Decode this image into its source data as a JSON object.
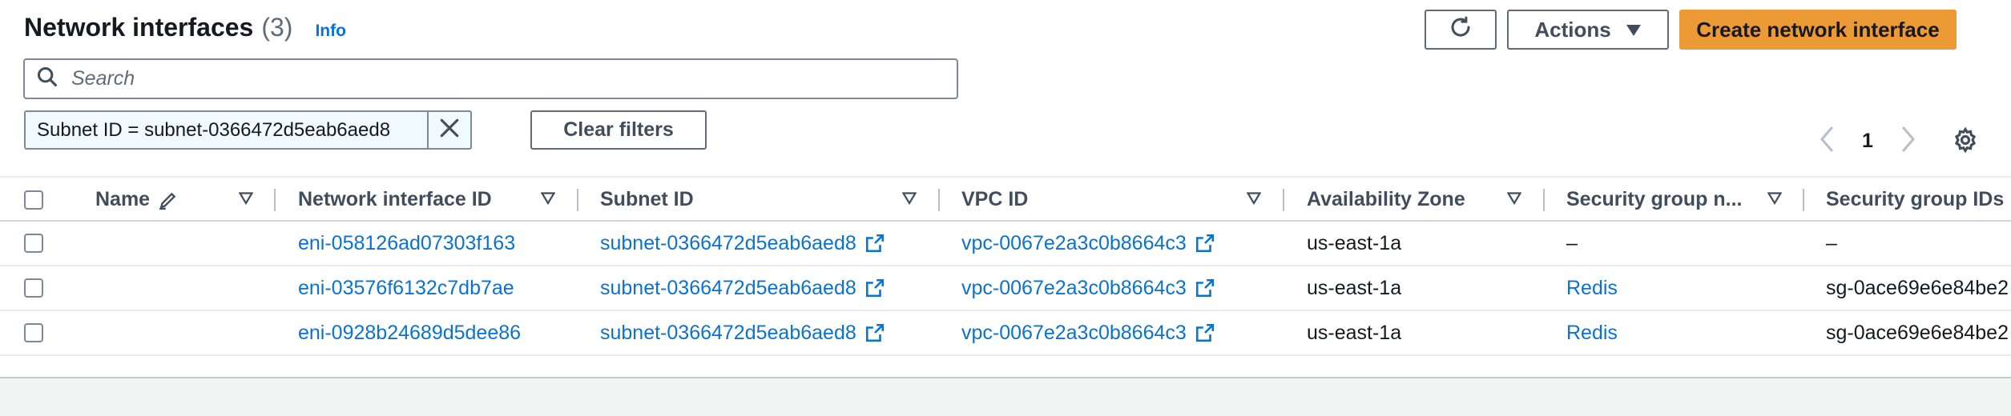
{
  "header": {
    "title": "Network interfaces",
    "count": "(3)",
    "info": "Info",
    "actions_label": "Actions",
    "create_label": "Create network interface"
  },
  "search": {
    "placeholder": "Search"
  },
  "filter": {
    "token": "Subnet ID = subnet-0366472d5eab6aed8",
    "clear_label": "Clear filters"
  },
  "pagination": {
    "current_page": "1"
  },
  "table": {
    "columns": [
      "Name",
      "Network interface ID",
      "Subnet ID",
      "VPC ID",
      "Availability Zone",
      "Security group n...",
      "Security group IDs"
    ],
    "rows": [
      {
        "name": "",
        "eni": "eni-058126ad07303f163",
        "subnet": "subnet-0366472d5eab6aed8",
        "vpc": "vpc-0067e2a3c0b8664c3",
        "az": "us-east-1a",
        "sg_name": "–",
        "sg_ids": "–"
      },
      {
        "name": "",
        "eni": "eni-03576f6132c7db7ae",
        "subnet": "subnet-0366472d5eab6aed8",
        "vpc": "vpc-0067e2a3c0b8664c3",
        "az": "us-east-1a",
        "sg_name": "Redis",
        "sg_ids": "sg-0ace69e6e84be2"
      },
      {
        "name": "",
        "eni": "eni-0928b24689d5dee86",
        "subnet": "subnet-0366472d5eab6aed8",
        "vpc": "vpc-0067e2a3c0b8664c3",
        "az": "us-east-1a",
        "sg_name": "Redis",
        "sg_ids": "sg-0ace69e6e84be2"
      }
    ]
  },
  "colors": {
    "link": "#0972d3",
    "primary_button": "#ec9a36",
    "text": "#16191f"
  }
}
